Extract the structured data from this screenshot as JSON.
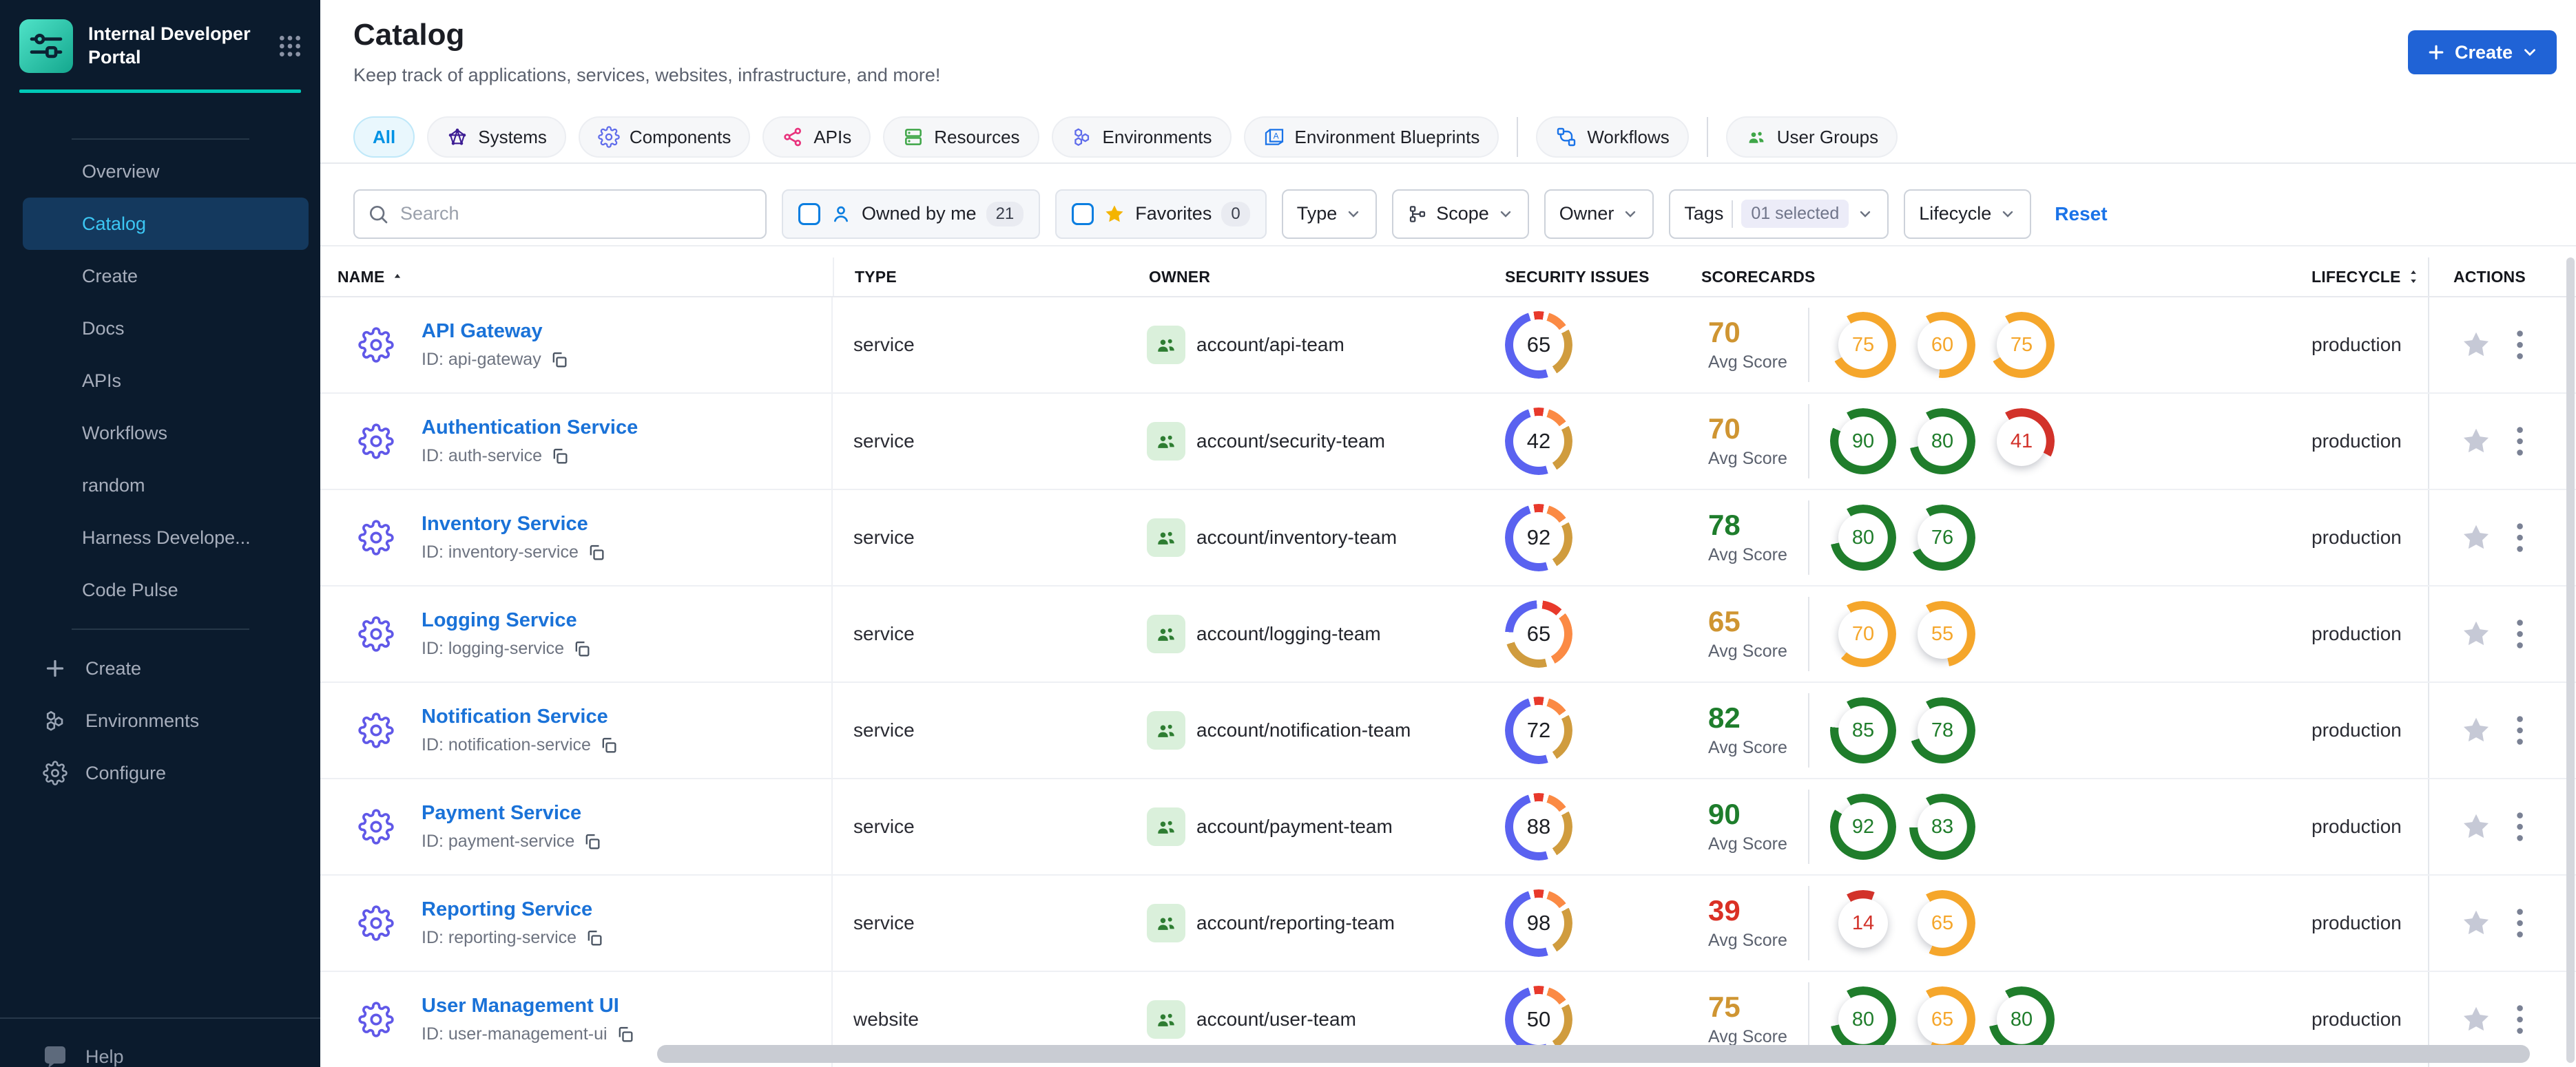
{
  "palette": {
    "accent_blue": "#2063d6",
    "link_blue": "#1a72d8",
    "active_tab_text": "#0092e4",
    "sidebar_bg": "#0b1b2d",
    "sidebar_active_bg": "#14395e",
    "sidebar_active_text": "#3cc7f4",
    "teal_accent": "#00c9b7",
    "ring_colors": {
      "amber": "#f5a62b",
      "green": "#1f7d2b",
      "red": "#d2322a"
    },
    "avg_colors": {
      "amber": "#cf9532",
      "green": "#1e7d2c",
      "red": "#da3025"
    }
  },
  "sidebar": {
    "logo_title": "Internal Developer Portal",
    "nav": [
      {
        "label": "Overview",
        "active": false
      },
      {
        "label": "Catalog",
        "active": true
      },
      {
        "label": "Create",
        "active": false
      },
      {
        "label": "Docs",
        "active": false
      },
      {
        "label": "APIs",
        "active": false
      },
      {
        "label": "Workflows",
        "active": false
      },
      {
        "label": "random",
        "active": false
      },
      {
        "label": "Harness Develope...",
        "active": false
      },
      {
        "label": "Code Pulse",
        "active": false
      }
    ],
    "bottom_nav": [
      {
        "label": "Create",
        "icon": "plus"
      },
      {
        "label": "Environments",
        "icon": "hexagons"
      },
      {
        "label": "Configure",
        "icon": "gear"
      }
    ],
    "help_label": "Help"
  },
  "header": {
    "title": "Catalog",
    "subtitle": "Keep track of applications, services, websites, infrastructure, and more!",
    "create_label": "Create"
  },
  "tabs": [
    {
      "label": "All",
      "icon": null,
      "icon_color": null,
      "active": true,
      "divider_before": false
    },
    {
      "label": "Systems",
      "icon": "systems",
      "icon_color": "#3d1d94",
      "active": false,
      "divider_before": false
    },
    {
      "label": "Components",
      "icon": "gear",
      "icon_color": "#5f6ceb",
      "active": false,
      "divider_before": false
    },
    {
      "label": "APIs",
      "icon": "api",
      "icon_color": "#e8327c",
      "active": false,
      "divider_before": false
    },
    {
      "label": "Resources",
      "icon": "stack",
      "icon_color": "#3fa648",
      "active": false,
      "divider_before": false
    },
    {
      "label": "Environments",
      "icon": "hexagons",
      "icon_color": "#5f6ceb",
      "active": false,
      "divider_before": false
    },
    {
      "label": "Environment Blueprints",
      "icon": "blueprint",
      "icon_color": "#1a73e8",
      "active": false,
      "divider_before": false
    },
    {
      "label": "Workflows",
      "icon": "workflow",
      "icon_color": "#1a73e8",
      "active": false,
      "divider_before": true
    },
    {
      "label": "User Groups",
      "icon": "people",
      "icon_color": "#3fa648",
      "active": false,
      "divider_before": true
    }
  ],
  "filters": {
    "search_placeholder": "Search",
    "owned_by_me": {
      "label": "Owned by me",
      "count": "21"
    },
    "favorites": {
      "label": "Favorites",
      "count": "0"
    },
    "dropdowns": [
      {
        "label": "Type",
        "icon": null,
        "value": null
      },
      {
        "label": "Scope",
        "icon": "scope",
        "value": null
      },
      {
        "label": "Owner",
        "icon": null,
        "value": null
      },
      {
        "label": "Tags",
        "icon": null,
        "value": "01 selected"
      },
      {
        "label": "Lifecycle",
        "icon": null,
        "value": null
      }
    ],
    "reset_label": "Reset"
  },
  "table": {
    "columns": [
      {
        "label": "NAME",
        "sort": "asc",
        "class": "th-name"
      },
      {
        "label": "TYPE",
        "sort": null,
        "class": "th-type"
      },
      {
        "label": "OWNER",
        "sort": null,
        "class": "th-owner"
      },
      {
        "label": "SECURITY ISSUES",
        "sort": null,
        "class": "th-sec"
      },
      {
        "label": "SCORECARDS",
        "sort": null,
        "class": "th-score"
      },
      {
        "label": "LIFECYCLE",
        "sort": "both",
        "class": "th-life"
      },
      {
        "label": "ACTIONS",
        "sort": null,
        "class": "th-act"
      }
    ],
    "id_prefix": "ID: ",
    "avg_score_label": "Avg Score",
    "donut_variants": {
      "v1": [
        {
          "color": "#e8392b",
          "from": 0,
          "to": 2.5
        },
        {
          "color": "#fb8a44",
          "from": 5,
          "to": 15
        },
        {
          "color": "#d09c3e",
          "from": 17.5,
          "to": 41
        },
        {
          "color": "#5a62f0",
          "from": 45.5,
          "to": 95
        },
        {
          "color": "#e8392b",
          "from": 97.5,
          "to": 100
        }
      ],
      "v2": [
        {
          "color": "#e8392b",
          "from": 2,
          "to": 12
        },
        {
          "color": "#fb8a44",
          "from": 14.5,
          "to": 42
        },
        {
          "color": "#d09c3e",
          "from": 46,
          "to": 70
        },
        {
          "color": "#5a62f0",
          "from": 76,
          "to": 99
        }
      ]
    },
    "rows": [
      {
        "name": "API Gateway",
        "id": "api-gateway",
        "type": "service",
        "owner": "account/api-team",
        "security_issues": 65,
        "donut": "v1",
        "avg_score": 70,
        "avg_color": "amber",
        "scorecards": [
          {
            "value": 75,
            "color": "amber"
          },
          {
            "value": 60,
            "color": "amber"
          },
          {
            "value": 75,
            "color": "amber"
          }
        ],
        "lifecycle": "production"
      },
      {
        "name": "Authentication Service",
        "id": "auth-service",
        "type": "service",
        "owner": "account/security-team",
        "security_issues": 42,
        "donut": "v1",
        "avg_score": 70,
        "avg_color": "amber",
        "scorecards": [
          {
            "value": 90,
            "color": "green"
          },
          {
            "value": 80,
            "color": "green"
          },
          {
            "value": 41,
            "color": "red"
          }
        ],
        "lifecycle": "production"
      },
      {
        "name": "Inventory Service",
        "id": "inventory-service",
        "type": "service",
        "owner": "account/inventory-team",
        "security_issues": 92,
        "donut": "v1",
        "avg_score": 78,
        "avg_color": "green",
        "scorecards": [
          {
            "value": 80,
            "color": "green"
          },
          {
            "value": 76,
            "color": "green"
          }
        ],
        "lifecycle": "production"
      },
      {
        "name": "Logging Service",
        "id": "logging-service",
        "type": "service",
        "owner": "account/logging-team",
        "security_issues": 65,
        "donut": "v2",
        "avg_score": 65,
        "avg_color": "amber",
        "scorecards": [
          {
            "value": 70,
            "color": "amber"
          },
          {
            "value": 55,
            "color": "amber"
          }
        ],
        "lifecycle": "production"
      },
      {
        "name": "Notification Service",
        "id": "notification-service",
        "type": "service",
        "owner": "account/notification-team",
        "security_issues": 72,
        "donut": "v1",
        "avg_score": 82,
        "avg_color": "green",
        "scorecards": [
          {
            "value": 85,
            "color": "green"
          },
          {
            "value": 78,
            "color": "green"
          }
        ],
        "lifecycle": "production"
      },
      {
        "name": "Payment Service",
        "id": "payment-service",
        "type": "service",
        "owner": "account/payment-team",
        "security_issues": 88,
        "donut": "v1",
        "avg_score": 90,
        "avg_color": "green",
        "scorecards": [
          {
            "value": 92,
            "color": "green"
          },
          {
            "value": 83,
            "color": "green"
          }
        ],
        "lifecycle": "production"
      },
      {
        "name": "Reporting Service",
        "id": "reporting-service",
        "type": "service",
        "owner": "account/reporting-team",
        "security_issues": 98,
        "donut": "v1",
        "avg_score": 39,
        "avg_color": "red",
        "scorecards": [
          {
            "value": 14,
            "color": "red"
          },
          {
            "value": 65,
            "color": "amber"
          }
        ],
        "lifecycle": "production"
      },
      {
        "name": "User Management UI",
        "id": "user-management-ui",
        "type": "website",
        "owner": "account/user-team",
        "security_issues": 50,
        "donut": "v1",
        "avg_score": 75,
        "avg_color": "amber",
        "scorecards": [
          {
            "value": 80,
            "color": "green"
          },
          {
            "value": 65,
            "color": "amber"
          },
          {
            "value": 80,
            "color": "green"
          }
        ],
        "lifecycle": "production"
      }
    ]
  }
}
